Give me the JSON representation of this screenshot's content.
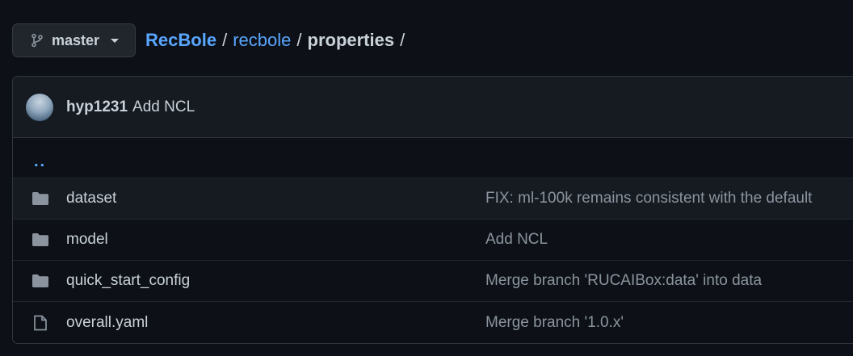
{
  "branch": {
    "name": "master"
  },
  "breadcrumb": {
    "repo": "RecBole",
    "folder": "recbole",
    "current": "properties",
    "separator": "/"
  },
  "commit": {
    "author": "hyp1231",
    "message": "Add NCL"
  },
  "parent_dir": "..",
  "files": [
    {
      "type": "folder",
      "icon": "folder-icon",
      "name": "dataset",
      "message": "FIX: ml-100k remains consistent with the default"
    },
    {
      "type": "folder",
      "icon": "folder-icon",
      "name": "model",
      "message": "Add NCL"
    },
    {
      "type": "folder",
      "icon": "folder-icon",
      "name": "quick_start_config",
      "message": "Merge branch 'RUCAIBox:data' into data"
    },
    {
      "type": "file",
      "icon": "file-icon",
      "name": "overall.yaml",
      "message": "Merge branch '1.0.x'"
    }
  ],
  "colors": {
    "link": "#58a6ff",
    "background": "#0d1117",
    "muted": "#8b949e"
  }
}
